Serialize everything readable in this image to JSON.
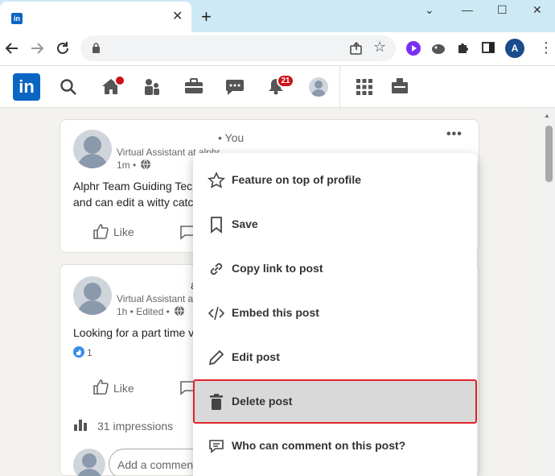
{
  "browser": {
    "new_tab_glyph": "+",
    "close_glyph": "✕",
    "window_controls": [
      "⌄",
      "—",
      "☐",
      "✕"
    ],
    "profile_initial": "A",
    "favicon_text": "in"
  },
  "linkedin": {
    "logo": "in",
    "notifications_badge": "21",
    "nav_icons": [
      "search-icon",
      "home-icon",
      "my-network-icon",
      "jobs-icon",
      "messaging-icon",
      "notifications-icon",
      "me-avatar",
      "work-grid-icon",
      "advertise-icon"
    ]
  },
  "post1": {
    "you_label": "• You",
    "subtitle": "Virtual Assistant at alphr",
    "meta": "1m •",
    "text_line1": "Alphr Team Guiding Tech",
    "text_line2": "and can edit a witty catch",
    "like": "Like",
    "more": "•••"
  },
  "post2": {
    "author_frag": "a",
    "subtitle": "Virtual Assistant at alphr",
    "meta": "1h • Edited •",
    "text": "Looking for a part time v",
    "reaction_count": "1",
    "like": "Like",
    "impressions": "31 impressions",
    "comment_placeholder": "Add a comment…"
  },
  "menu": {
    "items": [
      {
        "label": "Feature on top of profile",
        "icon": "star-icon"
      },
      {
        "label": "Save",
        "icon": "bookmark-icon"
      },
      {
        "label": "Copy link to post",
        "icon": "link-icon"
      },
      {
        "label": "Embed this post",
        "icon": "code-icon"
      },
      {
        "label": "Edit post",
        "icon": "pencil-icon"
      },
      {
        "label": "Delete post",
        "icon": "trash-icon",
        "highlighted": true
      },
      {
        "label": "Who can comment on this post?",
        "icon": "comment-icon"
      }
    ]
  },
  "colors": {
    "linkedin_blue": "#0a66c2",
    "badge_red": "#cc1016",
    "highlight_border": "#e0242c",
    "tabstrip": "#cde9f5"
  }
}
